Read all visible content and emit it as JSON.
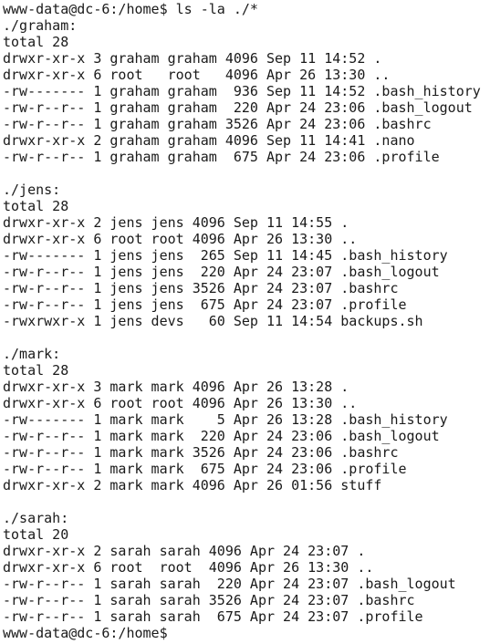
{
  "terminal": {
    "lines": [
      "www-data@dc-6:/home$ ls -la ./*",
      "./graham:",
      "total 28",
      "drwxr-xr-x 3 graham graham 4096 Sep 11 14:52 .",
      "drwxr-xr-x 6 root   root   4096 Apr 26 13:30 ..",
      "-rw------- 1 graham graham  936 Sep 11 14:52 .bash_history",
      "-rw-r--r-- 1 graham graham  220 Apr 24 23:06 .bash_logout",
      "-rw-r--r-- 1 graham graham 3526 Apr 24 23:06 .bashrc",
      "drwxr-xr-x 2 graham graham 4096 Sep 11 14:41 .nano",
      "-rw-r--r-- 1 graham graham  675 Apr 24 23:06 .profile",
      "",
      "./jens:",
      "total 28",
      "drwxr-xr-x 2 jens jens 4096 Sep 11 14:55 .",
      "drwxr-xr-x 6 root root 4096 Apr 26 13:30 ..",
      "-rw------- 1 jens jens  265 Sep 11 14:45 .bash_history",
      "-rw-r--r-- 1 jens jens  220 Apr 24 23:07 .bash_logout",
      "-rw-r--r-- 1 jens jens 3526 Apr 24 23:07 .bashrc",
      "-rw-r--r-- 1 jens jens  675 Apr 24 23:07 .profile",
      "-rwxrwxr-x 1 jens devs   60 Sep 11 14:54 backups.sh",
      "",
      "./mark:",
      "total 28",
      "drwxr-xr-x 3 mark mark 4096 Apr 26 13:28 .",
      "drwxr-xr-x 6 root root 4096 Apr 26 13:30 ..",
      "-rw------- 1 mark mark    5 Apr 26 13:28 .bash_history",
      "-rw-r--r-- 1 mark mark  220 Apr 24 23:06 .bash_logout",
      "-rw-r--r-- 1 mark mark 3526 Apr 24 23:06 .bashrc",
      "-rw-r--r-- 1 mark mark  675 Apr 24 23:06 .profile",
      "drwxr-xr-x 2 mark mark 4096 Apr 26 01:56 stuff",
      "",
      "./sarah:",
      "total 20",
      "drwxr-xr-x 2 sarah sarah 4096 Apr 24 23:07 .",
      "drwxr-xr-x 6 root  root  4096 Apr 26 13:30 ..",
      "-rw-r--r-- 1 sarah sarah  220 Apr 24 23:07 .bash_logout",
      "-rw-r--r-- 1 sarah sarah 3526 Apr 24 23:07 .bashrc",
      "-rw-r--r-- 1 sarah sarah  675 Apr 24 23:07 .profile",
      "www-data@dc-6:/home$"
    ]
  }
}
